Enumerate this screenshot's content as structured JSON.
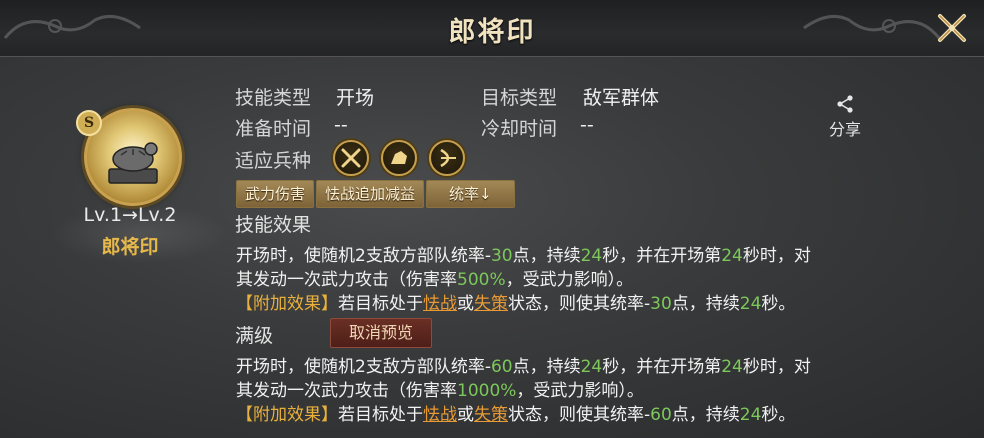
{
  "window": {
    "title": "郎将印"
  },
  "seal": {
    "grade": "S",
    "level": "Lv.1→Lv.2",
    "name": "郎将印"
  },
  "info": {
    "skill_type_label": "技能类型",
    "skill_type_value": "开场",
    "target_type_label": "目标类型",
    "target_type_value": "敌军群体",
    "prep_time_label": "准备时间",
    "prep_time_value": "--",
    "cooldown_label": "冷却时间",
    "cooldown_value": "--",
    "units_label": "适应兵种"
  },
  "units": [
    "spear-icon",
    "cavalry-icon",
    "archer-icon"
  ],
  "share": {
    "label": "分享"
  },
  "tags": [
    "武力伤害",
    "怯战追加减益",
    "统率↓"
  ],
  "effect": {
    "heading": "技能效果",
    "line1": {
      "a": "开场时，使随机2支敌方部队统率-",
      "n1": "30",
      "b": "点，持续",
      "n2": "24",
      "c": "秒，并在开场第",
      "n3": "24",
      "d": "秒时，对"
    },
    "line2": {
      "a": "其发动一次武力攻击（伤害率",
      "n1": "500%",
      "b": "，受武力影响）。"
    },
    "line3": {
      "bonus": "【附加效果】",
      "a": "若目标处于",
      "l1": "怯战",
      "b": "或",
      "l2": "失策",
      "c": "状态，则使其统率-",
      "n1": "30",
      "d": "点，持续",
      "n2": "24",
      "e": "秒。"
    }
  },
  "max": {
    "heading": "满级",
    "cancel_label": "取消预览",
    "line1": {
      "a": "开场时，使随机2支敌方部队统率-",
      "n1": "60",
      "b": "点，持续",
      "n2": "24",
      "c": "秒，并在开场第",
      "n3": "24",
      "d": "秒时，对"
    },
    "line2": {
      "a": "其发动一次武力攻击（伤害率",
      "n1": "1000%",
      "b": "，受武力影响）。"
    },
    "line3": {
      "bonus": "【附加效果】",
      "a": "若目标处于",
      "l1": "怯战",
      "b": "或",
      "l2": "失策",
      "c": "状态，则使其统率-",
      "n1": "60",
      "d": "点，持续",
      "n2": "24",
      "e": "秒。"
    }
  },
  "colors": {
    "gold": "#e7b84a",
    "green": "#7cc85a",
    "orange": "#e89b35"
  }
}
